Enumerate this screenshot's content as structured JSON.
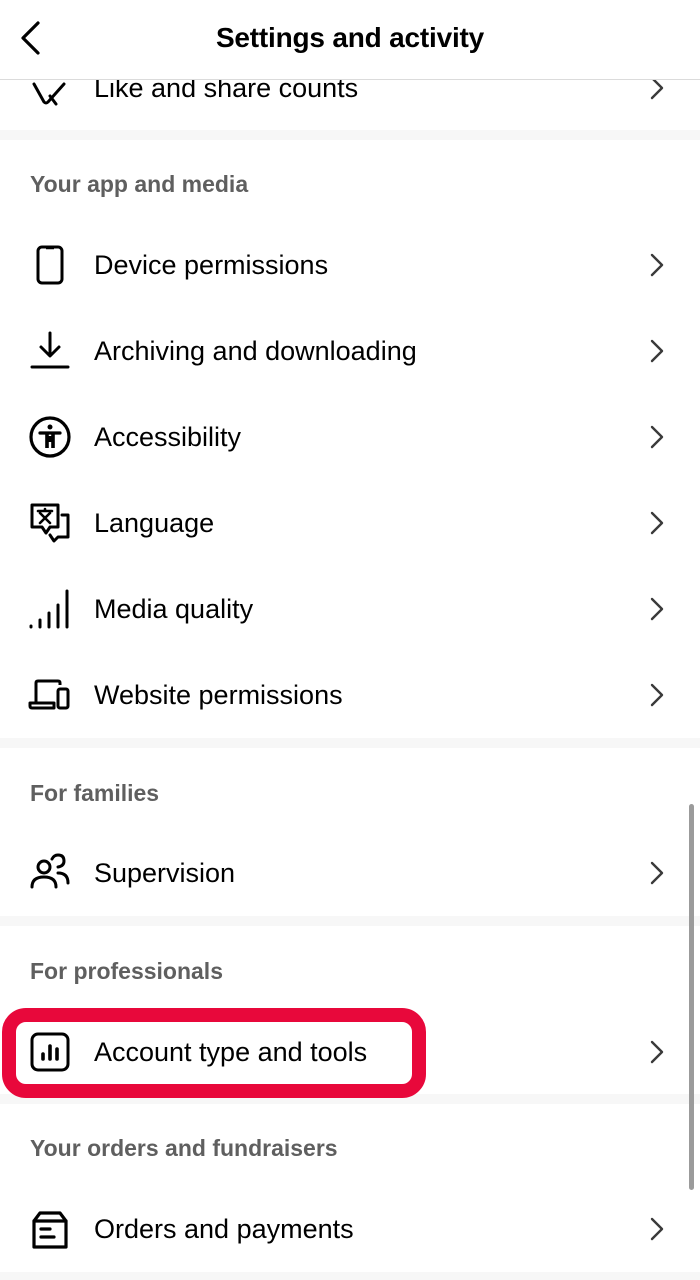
{
  "header": {
    "title": "Settings and activity",
    "back_icon": "chevron-left-icon"
  },
  "top_item": {
    "label": "Like and share counts",
    "icon": "hidden-likes-icon"
  },
  "sections": [
    {
      "title": "Your app and media",
      "items": [
        {
          "label": "Device permissions",
          "icon": "phone-icon"
        },
        {
          "label": "Archiving and downloading",
          "icon": "download-icon"
        },
        {
          "label": "Accessibility",
          "icon": "accessibility-icon"
        },
        {
          "label": "Language",
          "icon": "translate-icon"
        },
        {
          "label": "Media quality",
          "icon": "signal-bars-icon"
        },
        {
          "label": "Website permissions",
          "icon": "devices-icon"
        }
      ]
    },
    {
      "title": "For families",
      "items": [
        {
          "label": "Supervision",
          "icon": "people-icon"
        }
      ]
    },
    {
      "title": "For professionals",
      "items": [
        {
          "label": "Account type and tools",
          "icon": "chart-box-icon",
          "highlighted": true
        }
      ]
    },
    {
      "title": "Your orders and fundraisers",
      "items": [
        {
          "label": "Orders and payments",
          "icon": "box-icon"
        }
      ]
    }
  ],
  "colors": {
    "highlight": "#e8083b",
    "section_title": "#5f5f5f",
    "separator": "#f7f7f7",
    "chevron": "#3a3a3a"
  }
}
